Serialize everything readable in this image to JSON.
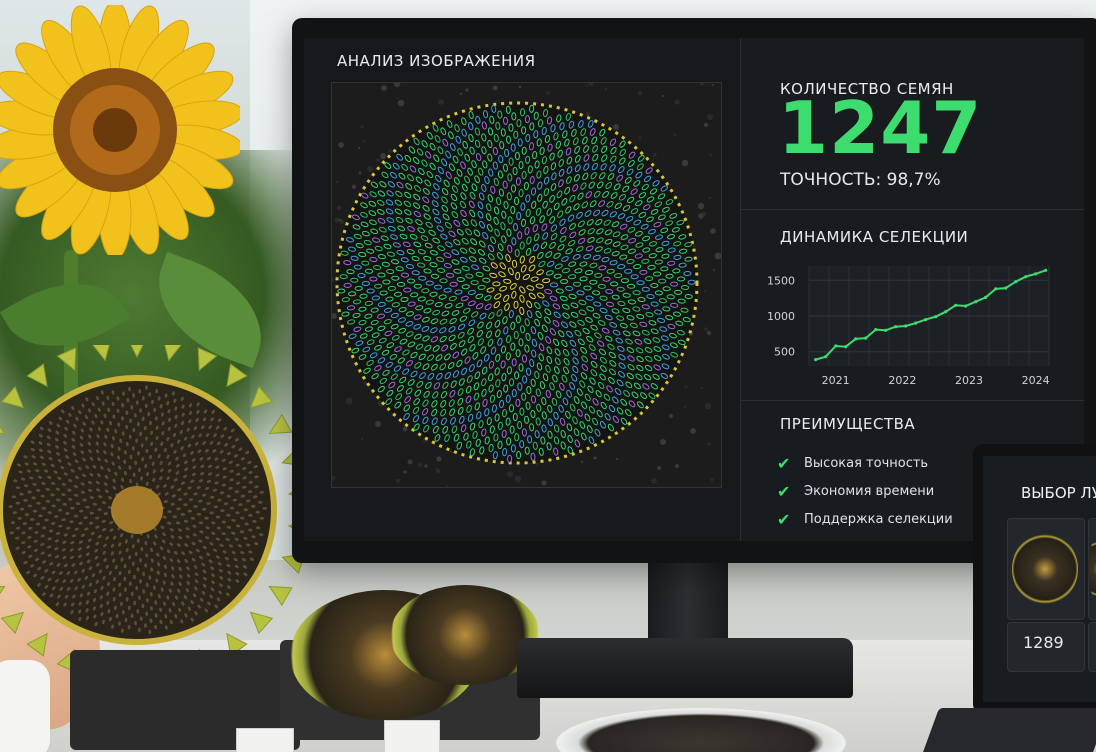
{
  "analysis": {
    "title": "АНАЛИЗ ИЗОБРАЖЕНИЯ"
  },
  "seeds": {
    "title": "КОЛИЧЕСТВО СЕМЯН",
    "count": "1247",
    "accuracy": "ТОЧНОСТЬ: 98,7%"
  },
  "dynamics": {
    "title": "ДИНАМИКА СЕЛЕКЦИИ"
  },
  "advantages": {
    "title": "ПРЕИМУЩЕСТВА",
    "items": [
      "Высокая точность",
      "Экономия времени",
      "Поддержка селекции"
    ]
  },
  "laptop": {
    "title": "ВЫБОР ЛУ",
    "card_value": "1289"
  },
  "colors": {
    "accent_green": "#3ddc6e",
    "panel_bg": "#191c1f"
  },
  "chart_data": {
    "type": "line",
    "title": "ДИНАМИКА СЕЛЕКЦИИ",
    "xlabel": "",
    "ylabel": "",
    "x_ticks": [
      "2021",
      "2022",
      "2023",
      "2024"
    ],
    "y_ticks": [
      500,
      1000,
      1500
    ],
    "xlim": [
      2020.6,
      2024.2
    ],
    "ylim": [
      300,
      1700
    ],
    "grid": true,
    "series": [
      {
        "x": [
          2020.7,
          2020.85,
          2021.0,
          2021.15,
          2021.3,
          2021.45,
          2021.6,
          2021.75,
          2021.9,
          2022.05,
          2022.2,
          2022.35,
          2022.5,
          2022.65,
          2022.8,
          2022.95,
          2023.1,
          2023.25,
          2023.4,
          2023.55,
          2023.7,
          2023.85,
          2024.0,
          2024.15
        ],
        "y": [
          390,
          430,
          580,
          570,
          680,
          690,
          810,
          800,
          850,
          860,
          900,
          950,
          990,
          1060,
          1150,
          1140,
          1200,
          1260,
          1380,
          1390,
          1480,
          1550,
          1590,
          1640
        ]
      }
    ]
  }
}
